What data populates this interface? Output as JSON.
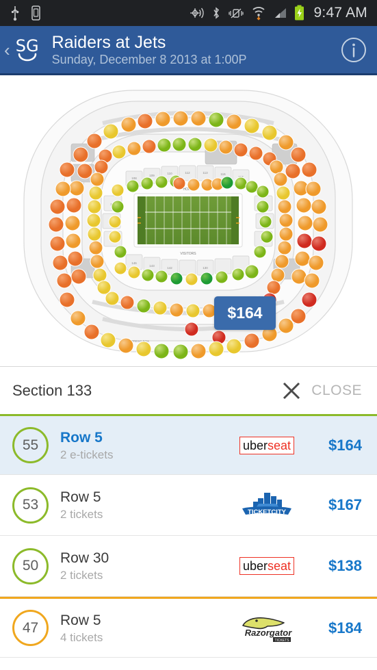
{
  "status_bar": {
    "time": "9:47 AM",
    "icons_left": [
      "usb-icon",
      "sim-card-icon"
    ],
    "icons_right": [
      "location-broadcast-icon",
      "bluetooth-icon",
      "vibrate-off-icon",
      "wifi-icon",
      "cellular-signal-icon",
      "battery-charging-icon"
    ],
    "background": "#1f2124"
  },
  "header": {
    "logo_text": "SG",
    "logo_name": "seatgeek-logo",
    "back_label": "‹",
    "title": "Raiders at Jets",
    "subtitle": "Sunday, December 8 2013 at 1:00P",
    "info_label": "i",
    "background": "#2f5a99"
  },
  "map": {
    "field_home_label": "HOME",
    "field_visitors_label": "VISITORS",
    "press_box_label": "PRESS BOX",
    "tooltip_price": "$164",
    "tooltip_color": "#3a6bab",
    "section_labels": [
      "101",
      "104",
      "106",
      "108",
      "109",
      "110",
      "112",
      "113",
      "114",
      "116",
      "117",
      "118",
      "121",
      "123",
      "124",
      "126",
      "140",
      "142",
      "143",
      "146",
      "148",
      "130"
    ]
  },
  "section_panel": {
    "title": "Section 133",
    "close_label": "CLOSE",
    "close_icon": "close-x-icon"
  },
  "listings": [
    {
      "score": "55",
      "score_color": "#8cba2a",
      "row": "Row 5",
      "quantity": "2 e-tickets",
      "vendor": "uberseat",
      "vendor_part_dark": "uber",
      "vendor_part_red": "seat",
      "price": "$164",
      "selected": true,
      "divider": "green"
    },
    {
      "score": "53",
      "score_color": "#8cba2a",
      "row": "Row 5",
      "quantity": "2 tickets",
      "vendor": "ticketcity",
      "vendor_label": "TICKETCITY",
      "price": "$167",
      "selected": false,
      "divider": "none"
    },
    {
      "score": "50",
      "score_color": "#8cba2a",
      "row": "Row 30",
      "quantity": "2 tickets",
      "vendor": "uberseat",
      "vendor_part_dark": "uber",
      "vendor_part_red": "seat",
      "price": "$138",
      "selected": false,
      "divider": "none"
    },
    {
      "score": "47",
      "score_color": "#f0a71e",
      "row": "Row 5",
      "quantity": "4 tickets",
      "vendor": "razorgator",
      "vendor_label": "Razorgator",
      "vendor_sublabel": "TICKETS",
      "price": "$184",
      "selected": false,
      "divider": "orange"
    }
  ]
}
